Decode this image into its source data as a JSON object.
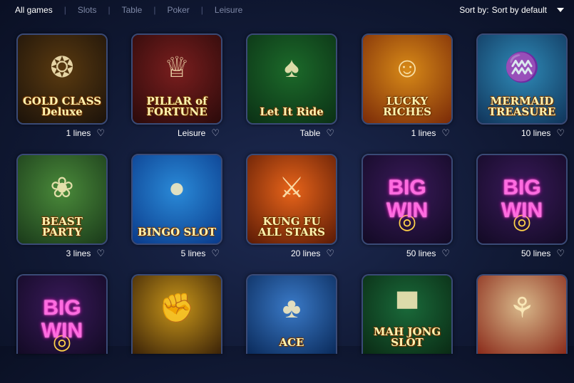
{
  "filters": {
    "tabs": [
      "All games",
      "Slots",
      "Table",
      "Poker",
      "Leisure"
    ],
    "sort_label": "Sort by:",
    "sort_value": "Sort by default"
  },
  "games": [
    {
      "title": "GOLD CLASS Deluxe",
      "meta": "1 lines",
      "icon": "casino-chip-icon",
      "bg": [
        "#5a3a10",
        "#1b120a"
      ]
    },
    {
      "title": "PILLAR of FORTUNE",
      "meta": "Leisure",
      "icon": "golden-pillar-icon",
      "bg": [
        "#7a1e1e",
        "#2a0a0a"
      ]
    },
    {
      "title": "Let It Ride",
      "meta": "Table",
      "icon": "playing-cards-icon",
      "bg": [
        "#1c6a2a",
        "#0b3015"
      ]
    },
    {
      "title": "LUCKY RICHES",
      "meta": "1 lines",
      "icon": "fortune-god-icon",
      "bg": [
        "#d88a18",
        "#7a2a08"
      ]
    },
    {
      "title": "MERMAID TREASURE",
      "meta": "10 lines",
      "icon": "mermaid-icon",
      "bg": [
        "#2f8bb8",
        "#10345a"
      ]
    },
    {
      "title": "BEAST PARTY",
      "meta": "3 lines",
      "icon": "panda-icon",
      "bg": [
        "#4a8a3a",
        "#1a3a1a"
      ]
    },
    {
      "title": "BINGO SLOT",
      "meta": "5 lines",
      "icon": "bingo-balls-icon",
      "bg": [
        "#2a8ad8",
        "#0a3a8a"
      ]
    },
    {
      "title": "KUNG FU ALL STARS",
      "meta": "20 lines",
      "icon": "fighter-icon",
      "bg": [
        "#e8641a",
        "#5a1a05"
      ]
    },
    {
      "title": "BIG WIN",
      "meta": "50 lines",
      "icon": "coins-icon",
      "bg": [
        "#3a1a5a",
        "#120a24"
      ],
      "bigwin": true
    },
    {
      "title": "BIG WIN",
      "meta": "50 lines",
      "icon": "coins-icon",
      "bg": [
        "#3a1a5a",
        "#120a24"
      ],
      "bigwin": true
    },
    {
      "title": "BIG WIN",
      "meta": "",
      "icon": "coins-icon",
      "bg": [
        "#3a1a5a",
        "#120a24"
      ],
      "bigwin": true,
      "cut": true
    },
    {
      "title": "",
      "meta": "",
      "icon": "martial-artist-icon",
      "bg": [
        "#c8961a",
        "#3a2208"
      ],
      "cut": true
    },
    {
      "title": "ACE",
      "meta": "",
      "icon": "chef-icon",
      "bg": [
        "#3a7ac8",
        "#0a2a5a"
      ],
      "cut": true
    },
    {
      "title": "MAH JONG SLOT",
      "meta": "",
      "icon": "mahjong-tiles-icon",
      "bg": [
        "#1a6a3a",
        "#0a2a14"
      ],
      "cut": true
    },
    {
      "title": "",
      "meta": "",
      "icon": "lady-fan-icon",
      "bg": [
        "#d8b88a",
        "#8a2a1a"
      ],
      "cut": true
    }
  ]
}
